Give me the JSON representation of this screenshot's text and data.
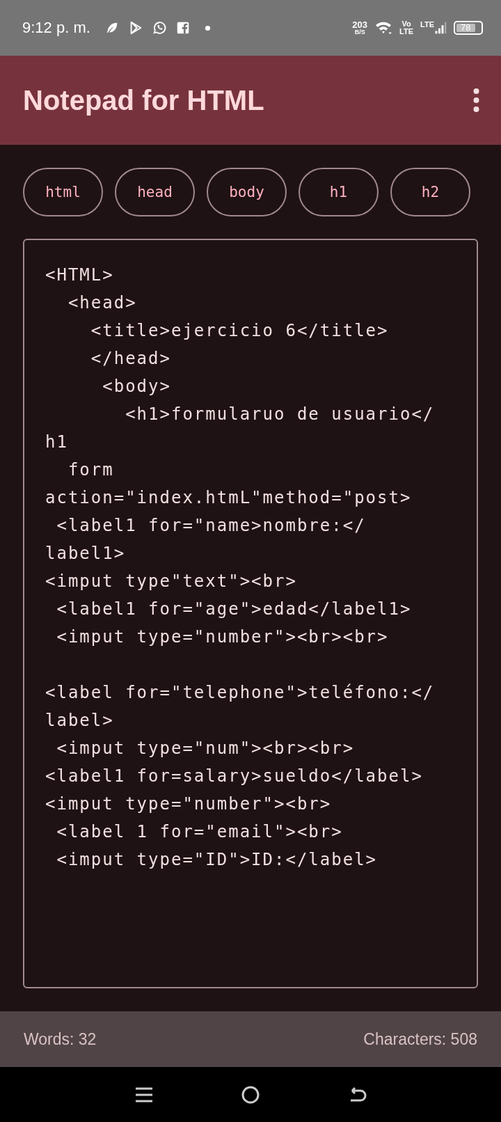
{
  "status_bar": {
    "time": "9:12 p. m.",
    "speed": "203",
    "speed_unit": "B/S",
    "volte_top": "Vo",
    "volte_bottom": "LTE",
    "network": "LTE",
    "battery": "78"
  },
  "app_bar": {
    "title": "Notepad for HTML"
  },
  "tag_buttons": [
    "html",
    "head",
    "body",
    "h1",
    "h2"
  ],
  "editor": {
    "value": "<HTML>\n  <head>\n    <title>ejercicio 6</title>\n    </head>\n     <body>\n       <h1>formularuo de usuario</\nh1\n  form\naction=\"index.htmL\"method=\"post>\n <label1 for=\"name>nombre:</\nlabel1>\n<imput type\"text\"><br>\n <label1 for=\"age\">edad</label1>\n <imput type=\"number\"><br><br>\n\n<label for=\"telephone\">teléfono:</\nlabel>\n <imput type=\"num\"><br><br>\n<label1 for=salary>sueldo</label>\n<imput type=\"number\"><br>\n <label 1 for=\"email\"><br>\n <imput type=\"ID\">ID:</label>"
  },
  "footer": {
    "words": "Words: 32",
    "characters": "Characters: 508"
  }
}
